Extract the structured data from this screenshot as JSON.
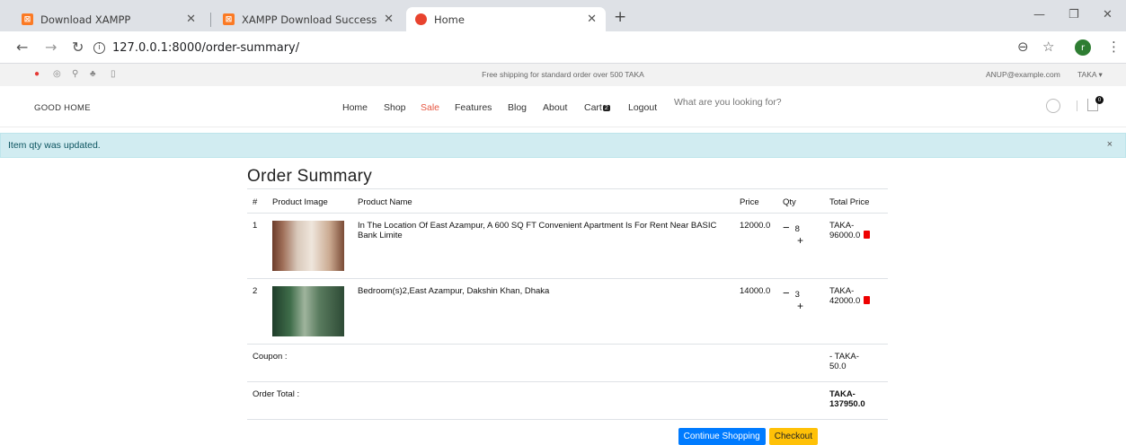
{
  "browser": {
    "tabs": [
      {
        "title": "Download XAMPP"
      },
      {
        "title": "XAMPP Download Success"
      },
      {
        "title": "Home"
      }
    ],
    "url": "127.0.0.1:8000/order-summary/",
    "profile_initial": "r"
  },
  "topbar": {
    "shipping_message": "Free shipping for standard order over 500 TAKA",
    "account_email": "ANUP@example.com",
    "currency": "TAKA"
  },
  "header": {
    "logo": "GOOD HOME",
    "menu": [
      "Home",
      "Shop",
      "Sale",
      "Features",
      "Blog",
      "About",
      "Cart",
      "Logout"
    ],
    "cart_count": "2",
    "search_placeholder": "What are you looking for?",
    "bag_count": "0"
  },
  "alert": {
    "message": "Item qty was updated.",
    "close": "×"
  },
  "summary": {
    "title": "Order Summary",
    "columns": [
      "#",
      "Product Image",
      "Product Name",
      "Price",
      "Qty",
      "Total Price"
    ],
    "items": [
      {
        "index": "1",
        "name": "In The Location Of East Azampur, A 600 SQ FT Convenient Apartment Is For Rent Near BASIC Bank Limite",
        "price": "12000.0",
        "qty": "8",
        "total_line1": "TAKA-",
        "total_line2": "96000.0"
      },
      {
        "index": "2",
        "name": "Bedroom(s)2,East Azampur, Dakshin Khan, Dhaka",
        "price": "14000.0",
        "qty": "3",
        "total_line1": "TAKA-",
        "total_line2": "42000.0"
      }
    ],
    "coupon_label": "Coupon :",
    "coupon_line1": "- TAKA-",
    "coupon_line2": "50.0",
    "total_label": "Order Total :",
    "total_line1": "TAKA-",
    "total_line2": "137950.0",
    "continue_label": "Continue Shopping",
    "checkout_label": "Checkout"
  }
}
